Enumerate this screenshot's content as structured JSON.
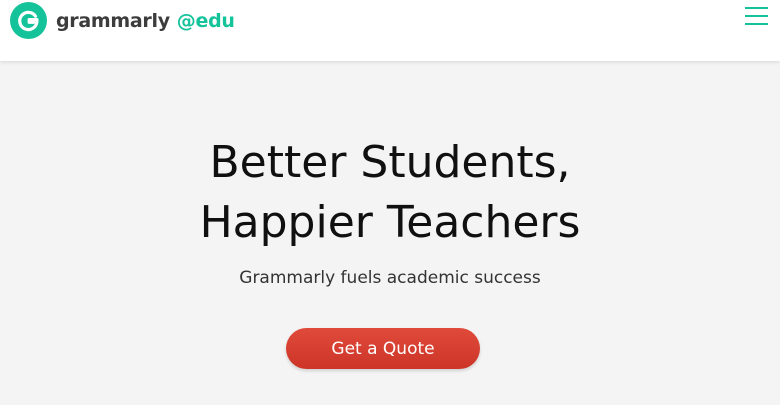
{
  "header": {
    "brand_name": "grammarly",
    "brand_suffix": "@edu",
    "logo_icon": "grammarly-g-logo-icon",
    "menu_icon": "hamburger-menu-icon"
  },
  "hero": {
    "headline_line1": "Better Students,",
    "headline_line2": "Happier Teachers",
    "subheadline": "Grammarly fuels academic success",
    "cta_label": "Get a Quote"
  },
  "colors": {
    "brand_green": "#15c39a",
    "cta_red": "#d93d2e",
    "page_background": "#f4f4f4",
    "header_background": "#ffffff"
  }
}
